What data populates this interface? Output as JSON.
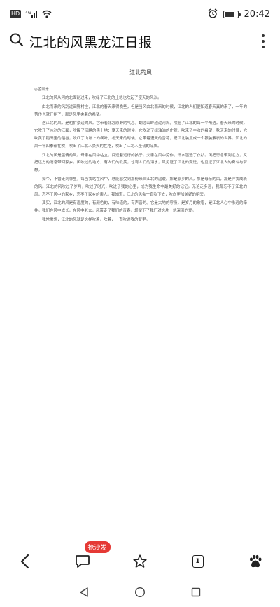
{
  "status_bar": {
    "carrier_badge": "HD",
    "signal": "4G",
    "time": "20:42"
  },
  "search": {
    "query": "江北的风黑龙江日报"
  },
  "document": {
    "title": "江北的风",
    "author": "◎孟凯东",
    "paragraphs": [
      "江北的风从河的北面刮过来，吹绿了江北的土地也吹起了漫天的风沙。",
      "由北而来的风刮过田野村庄，江北的春天来得晚些，但是当风由北而来的时候，江北的人们便知道春天真的来了，一年的劳作也就开始了，那是风里夹着的希望。",
      "这江北的风，是粗犷豪迈的风。它带着北方原野的气息，翻过山岭越过河流，吹遍了江北的每一个角落。春天来的时候，它吹开了冰封的江面，吹醒了沉睡的黑土地；夏天来的时候，它吹动了绿油油的庄稼，吹来了丰收的希望；秋天来的时候，它吹黄了稻田里的稻谷，吹红了山坡上的枫叶；冬天来的时候，它带着漫天的雪花，把江北装点成一个银装素裹的世界。江北的风一年四季都在吹，吹出了江北人豪爽的性格，吹出了江北人坚韧的品质。",
      "江北的风是温情的风。母亲在风中站立，目送着远行的孩子。父亲在风中劳作，汗水湿透了衣衫。风把思念带到远方，又把远方的消息带回家乡。风吹过的地方，有人们的欢笑，也有人们的泪水，风见证了江北的变迁，也见证了江北人的奋斗与梦想。",
      "如今，不管走到哪里，每当我站在风中，总能感受到那份来自江北的温暖。那是家乡的风，那是母亲的风，那是伴我成长的风。江北的风吹过了岁月，吹过了时光，吹进了我的心里，成为我生命中最美好的记忆。无论走多远，我都忘不了江北的风，忘不了风中的家乡，忘不了家乡的亲人。我知道，江北的风会一直吹下去，吹向更加美好的明天。",
      "其实，江北的风是有温度的，有颜色的，有味道的，有声音的。它是大地的呼吸，是岁月的歌唱，是江北人心中永远的牵挂。我们在风中成长，在风中老去，风带走了我们的青春，却留下了我们对这片土地深深的爱。",
      "我常常想，江北的风就是这样吹着，吹着，一直吹进我的梦里。"
    ]
  },
  "toolbar": {
    "back_icon": "back-arrow-icon",
    "comment_icon": "comment-icon",
    "sofa_label": "抢沙发",
    "favorite_icon": "star-icon",
    "page_count": "1",
    "share_icon": "paw-icon"
  },
  "navbar": {
    "back": "triangle-back-icon",
    "home": "circle-home-icon",
    "recents": "square-recents-icon"
  },
  "colors": {
    "badge_red": "#e53935",
    "text_dark": "#222222"
  }
}
